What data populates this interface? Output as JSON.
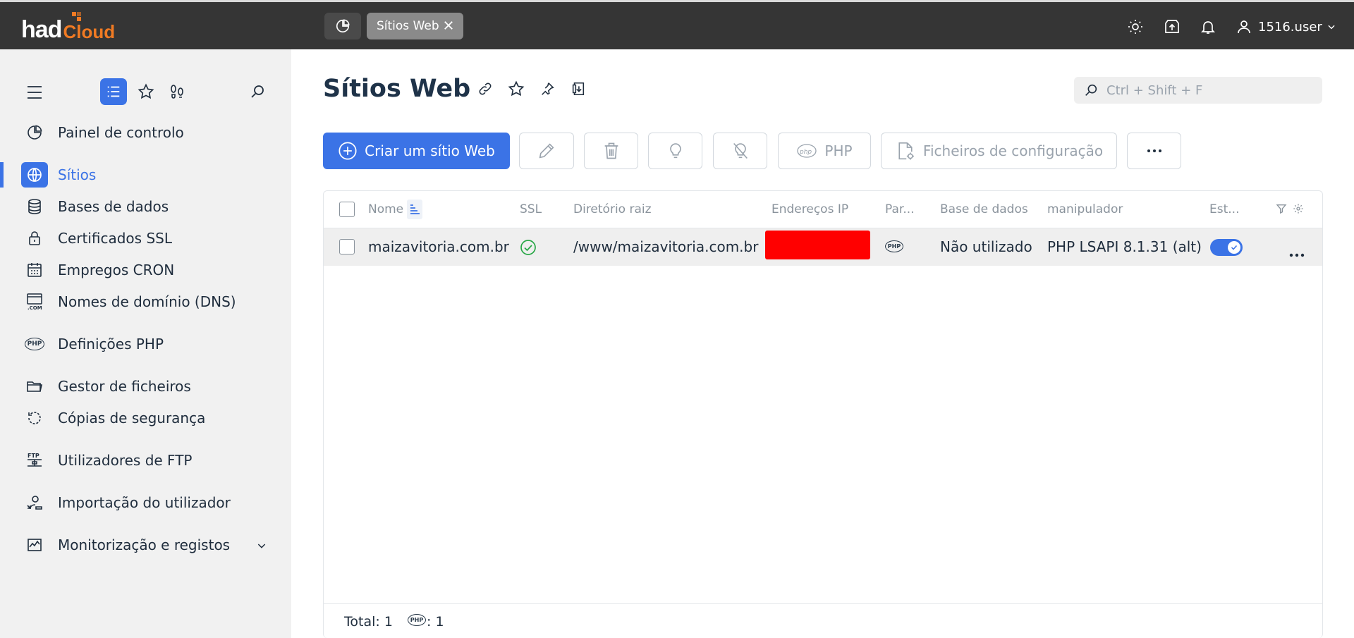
{
  "brand": {
    "part1": "had",
    "part2": "Cloud",
    "accent": "#f07a23"
  },
  "topbar": {
    "dashboard_icon": "pie-chart-icon",
    "tab_label": "Sítios Web",
    "icons": [
      "sun-icon",
      "upload-icon",
      "bell-icon",
      "user-icon"
    ],
    "username": "1516.user"
  },
  "sidebar": {
    "top_icons": [
      "menu-icon",
      "list-icon",
      "star-icon",
      "footprints-icon",
      "search-icon"
    ],
    "items": [
      {
        "label": "Painel de controlo",
        "icon": "pie-chart-icon"
      },
      {
        "label": "Sítios",
        "icon": "globe-icon",
        "active": true
      },
      {
        "label": "Bases de dados",
        "icon": "database-icon"
      },
      {
        "label": "Certificados SSL",
        "icon": "lock-icon"
      },
      {
        "label": "Empregos CRON",
        "icon": "calendar-icon"
      },
      {
        "label": "Nomes de domínio (DNS)",
        "icon": "dns-icon"
      },
      {
        "label": "Definições PHP",
        "icon": "php-icon"
      },
      {
        "label": "Gestor de ficheiros",
        "icon": "folder-icon"
      },
      {
        "label": "Cópias de segurança",
        "icon": "backup-icon"
      },
      {
        "label": "Utilizadores de FTP",
        "icon": "ftp-icon"
      },
      {
        "label": "Importação do utilizador",
        "icon": "user-import-icon"
      },
      {
        "label": "Monitorização e registos",
        "icon": "chart-icon"
      }
    ],
    "dns_badge": ".COM",
    "php_badge": "PHP",
    "ftp_badge": "FTP"
  },
  "main": {
    "title": "Sítios Web",
    "search_placeholder": "Ctrl + Shift + F",
    "toolbar": {
      "create_label": "Criar um sítio Web",
      "php_label": "PHP",
      "config_label": "Ficheiros de configuração"
    },
    "table": {
      "headers": {
        "name": "Nome",
        "ssl": "SSL",
        "root": "Diretório raiz",
        "ip": "Endereços IP",
        "params": "Par...",
        "db": "Base de dados",
        "handler": "manipulador",
        "status": "Est..."
      },
      "rows": [
        {
          "name": "maizavitoria.com.br",
          "root": "/www/maizavitoria.com.br",
          "db": "Não utilizado",
          "handler": "PHP LSAPI 8.1.31 (alt)"
        }
      ],
      "footer": {
        "total_label": "Total: 1",
        "php_count": ": 1"
      }
    }
  },
  "colors": {
    "primary": "#3b73e6",
    "topbar": "#353535",
    "sidebar": "#f1f1f1",
    "success": "#27a745"
  }
}
